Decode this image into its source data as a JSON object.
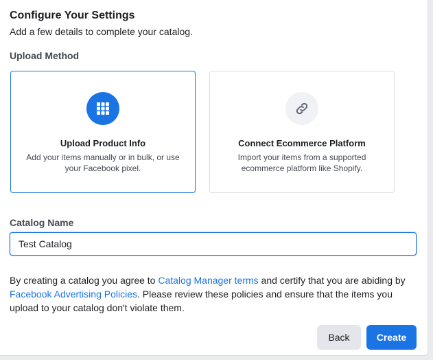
{
  "dialog": {
    "title": "Configure Your Settings",
    "subtitle": "Add a few details to complete your catalog."
  },
  "upload_method": {
    "label": "Upload Method",
    "options": [
      {
        "title": "Upload Product Info",
        "description": "Add your items manually or in bulk, or use your Facebook pixel.",
        "icon": "grid-icon",
        "selected": true
      },
      {
        "title": "Connect Ecommerce Platform",
        "description": "Import your items from a supported ecommerce platform like Shopify.",
        "icon": "link-icon",
        "selected": false
      }
    ]
  },
  "catalog_name": {
    "label": "Catalog Name",
    "value": "Test Catalog"
  },
  "terms": {
    "text_1": "By creating a catalog you agree to ",
    "link_1": "Catalog Manager terms",
    "text_2": " and certify that you are abiding by ",
    "link_2": "Facebook Advertising Policies",
    "text_3": ". Please review these policies and ensure that the items you upload to your catalog don't violate them."
  },
  "buttons": {
    "back": "Back",
    "create": "Create"
  },
  "colors": {
    "accent": "#1b74e4",
    "border": "#dadde1",
    "secondary_button": "#e4e6eb"
  }
}
